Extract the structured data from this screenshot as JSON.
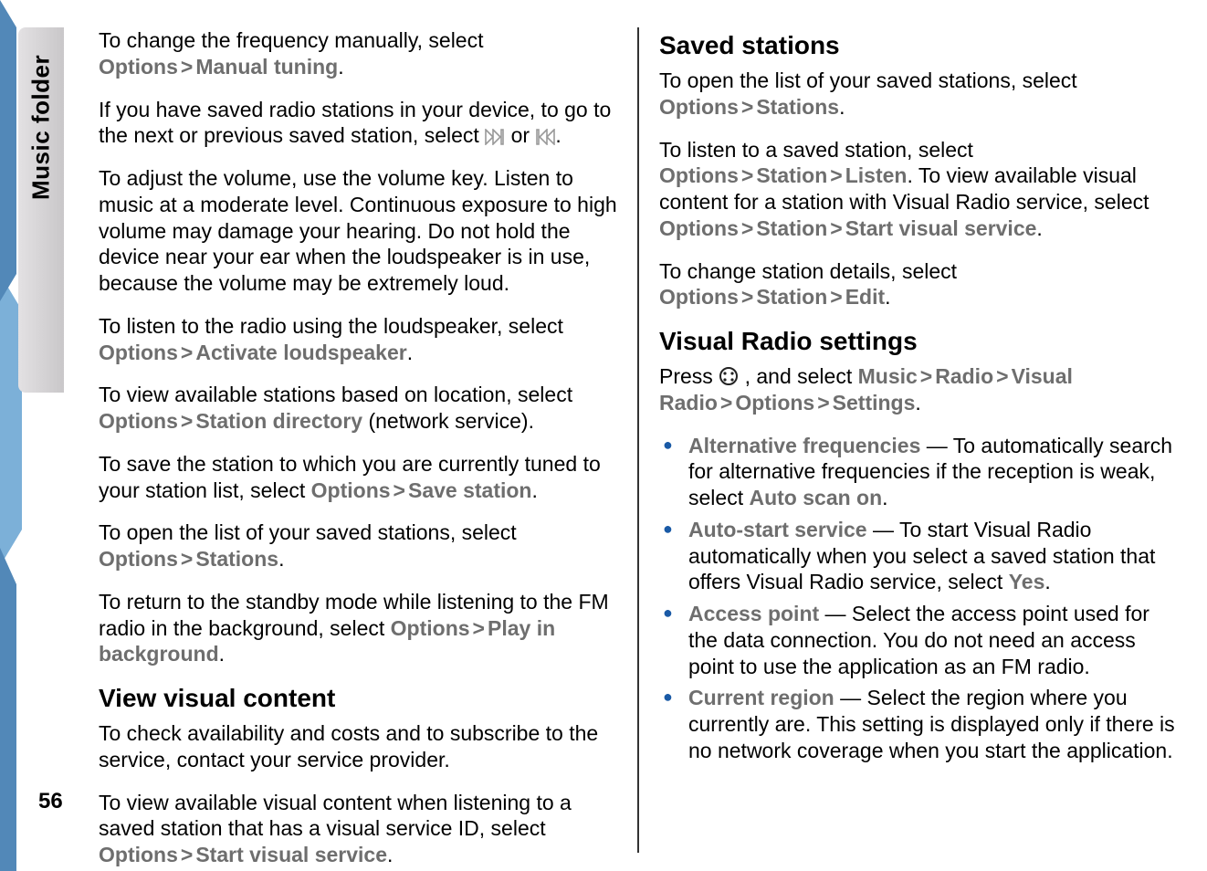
{
  "side": {
    "label": "Music folder"
  },
  "page": {
    "number": "56"
  },
  "left": {
    "p1": {
      "t1": "To change the frequency manually, select ",
      "k1": "Options",
      "k2": "Manual tuning",
      "t2": "."
    },
    "p2": {
      "t1": "If you have saved radio stations in your device, to go to the next or previous saved station, select ",
      "t2": " or ",
      "t3": "."
    },
    "p3": "To adjust the volume, use the volume key. Listen to music at a moderate level. Continuous exposure to high volume may damage your hearing. Do not hold the device near your ear when the loudspeaker is in use, because the volume may be extremely loud.",
    "p4": {
      "t1": "To listen to the radio using the loudspeaker, select ",
      "k1": "Options",
      "k2": "Activate loudspeaker",
      "t2": "."
    },
    "p5": {
      "t1": "To view available stations based on location, select ",
      "k1": "Options",
      "k2": "Station directory",
      "t2": " (network service)."
    },
    "p6": {
      "t1": "To save the station to which you are currently tuned to your station list, select ",
      "k1": "Options",
      "k2": "Save station",
      "t2": "."
    },
    "p7": {
      "t1": "To open the list of your saved stations, select ",
      "k1": "Options",
      "k2": "Stations",
      "t2": "."
    },
    "p8": {
      "t1": "To return to the standby mode while listening to the FM radio in the background, select ",
      "k1": "Options",
      "k2": "Play in background",
      "t2": "."
    },
    "h1": "View visual content",
    "p9": "To check availability and costs and to subscribe to the service, contact your service provider.",
    "p10": {
      "t1": "To view available visual content when listening to a saved station that has a visual service ID, select ",
      "k1": "Options",
      "k2": "Start visual service",
      "t2": "."
    }
  },
  "right": {
    "h1": "Saved stations",
    "p1": {
      "t1": "To open the list of your saved stations, select ",
      "k1": "Options",
      "k2": "Stations",
      "t2": "."
    },
    "p2": {
      "t1": "To listen to a saved station, select ",
      "k1": "Options",
      "k2": "Station",
      "k3": "Listen",
      "t2": ". To view available visual content for a station with Visual Radio service, select ",
      "k4": "Options",
      "k5": "Station",
      "k6": "Start visual service",
      "t3": "."
    },
    "p3": {
      "t1": "To change station details, select ",
      "k1": "Options",
      "k2": "Station",
      "k3": "Edit",
      "t2": "."
    },
    "h2": "Visual Radio settings",
    "p4": {
      "t1": "Press ",
      "t2": " , and select ",
      "k1": "Music",
      "k2": "Radio",
      "k3": "Visual Radio",
      "k4": "Options",
      "k5": "Settings",
      "t3": "."
    },
    "bullets": {
      "b1": {
        "k1": "Alternative frequencies",
        "t1": "  — To automatically search for alternative frequencies if the reception is weak, select ",
        "k2": "Auto scan on",
        "t2": "."
      },
      "b2": {
        "k1": "Auto-start service",
        "t1": "  — To start Visual Radio automatically when you select a saved station that offers Visual Radio service, select ",
        "k2": "Yes",
        "t2": "."
      },
      "b3": {
        "k1": "Access point",
        "t1": "  — Select the access point used for the data connection. You do not need an access point to use the application as an FM radio."
      },
      "b4": {
        "k1": "Current region",
        "t1": "  — Select the region where you currently are. This setting is displayed only if there is no network coverage when you start the application."
      }
    }
  }
}
